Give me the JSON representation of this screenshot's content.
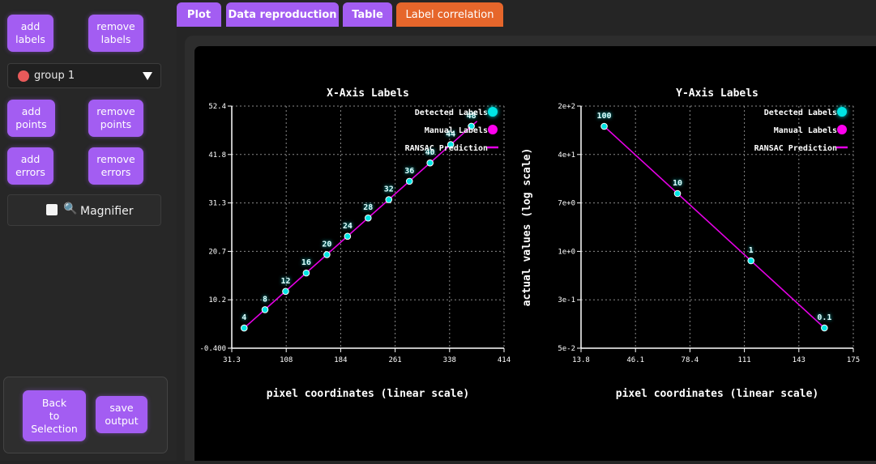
{
  "sidebar": {
    "add_labels": "add\nlabels",
    "remove_labels": "remove\nlabels",
    "group_select": {
      "value": "group 1",
      "color": "#e85a5a"
    },
    "add_points": "add\npoints",
    "remove_points": "remove\npoints",
    "add_errors": "add\nerrors",
    "remove_errors": "remove\nerrors",
    "magnifier": {
      "label": "Magnifier",
      "checked": false,
      "icon": "magnifier-icon"
    },
    "back_to_selection": "Back\nto\nSelection",
    "save_output": "save\noutput"
  },
  "tabs": [
    {
      "label": "Plot",
      "active": false
    },
    {
      "label": "Data reproduction",
      "active": false
    },
    {
      "label": "Table",
      "active": false
    },
    {
      "label": "Label correlation",
      "active": true
    }
  ],
  "colors": {
    "accent": "#a35df2",
    "active_tab": "#e6662b",
    "detected": "#00e5e5",
    "manual": "#ff00ee",
    "ransac": "#e600e6"
  },
  "chart_data": [
    {
      "type": "scatter",
      "title": "X-Axis Labels",
      "xlabel": "pixel coordinates (linear scale)",
      "ylabel": "",
      "x_ticks": [
        "31.3",
        "108",
        "184",
        "261",
        "338",
        "414"
      ],
      "y_ticks": [
        "-0.400",
        "10.2",
        "20.7",
        "31.3",
        "41.8",
        "52.4"
      ],
      "xlim": [
        31.3,
        414
      ],
      "ylim": [
        -0.4,
        52.4
      ],
      "legend": [
        "Detected Labels",
        "Manual Labels",
        "RANSAC Prediction"
      ],
      "legend_position": "top-right",
      "grid": true,
      "points": [
        {
          "x": 48.7,
          "y": 4,
          "label": "4"
        },
        {
          "x": 78,
          "y": 8,
          "label": "8"
        },
        {
          "x": 107,
          "y": 12,
          "label": "12"
        },
        {
          "x": 136,
          "y": 16,
          "label": "16"
        },
        {
          "x": 165,
          "y": 20,
          "label": "20"
        },
        {
          "x": 194,
          "y": 24,
          "label": "24"
        },
        {
          "x": 223,
          "y": 28,
          "label": "28"
        },
        {
          "x": 252,
          "y": 32,
          "label": "32"
        },
        {
          "x": 281,
          "y": 36,
          "label": "36"
        },
        {
          "x": 310,
          "y": 40,
          "label": "40"
        },
        {
          "x": 339,
          "y": 44,
          "label": "44"
        },
        {
          "x": 368,
          "y": 48,
          "label": "48"
        }
      ],
      "fit": {
        "x": [
          48.7,
          376
        ],
        "y": [
          4,
          49.1
        ]
      }
    },
    {
      "type": "scatter",
      "title": "Y-Axis Labels",
      "xlabel": "pixel coordinates (linear scale)",
      "ylabel": "actual values (log scale)",
      "x_ticks": [
        "13.8",
        "46.1",
        "78.4",
        "111",
        "143",
        "175"
      ],
      "y_ticks": [
        "5e-2",
        "3e-1",
        "1e+0",
        "7e+0",
        "4e+1",
        "2e+2"
      ],
      "xlim": [
        13.8,
        175
      ],
      "ylim": [
        0.05,
        200
      ],
      "y_scale": "log",
      "legend": [
        "Detected Labels",
        "Manual Labels",
        "RANSAC Prediction"
      ],
      "legend_position": "top-right",
      "grid": true,
      "points": [
        {
          "x": 27.5,
          "y": 100,
          "label": "100"
        },
        {
          "x": 70.9,
          "y": 10,
          "label": "10"
        },
        {
          "x": 114.4,
          "y": 1,
          "label": "1"
        },
        {
          "x": 157.9,
          "y": 0.1,
          "label": "0.1"
        }
      ],
      "fit": {
        "x": [
          27.5,
          157.9
        ],
        "y": [
          100,
          0.1
        ]
      }
    }
  ]
}
